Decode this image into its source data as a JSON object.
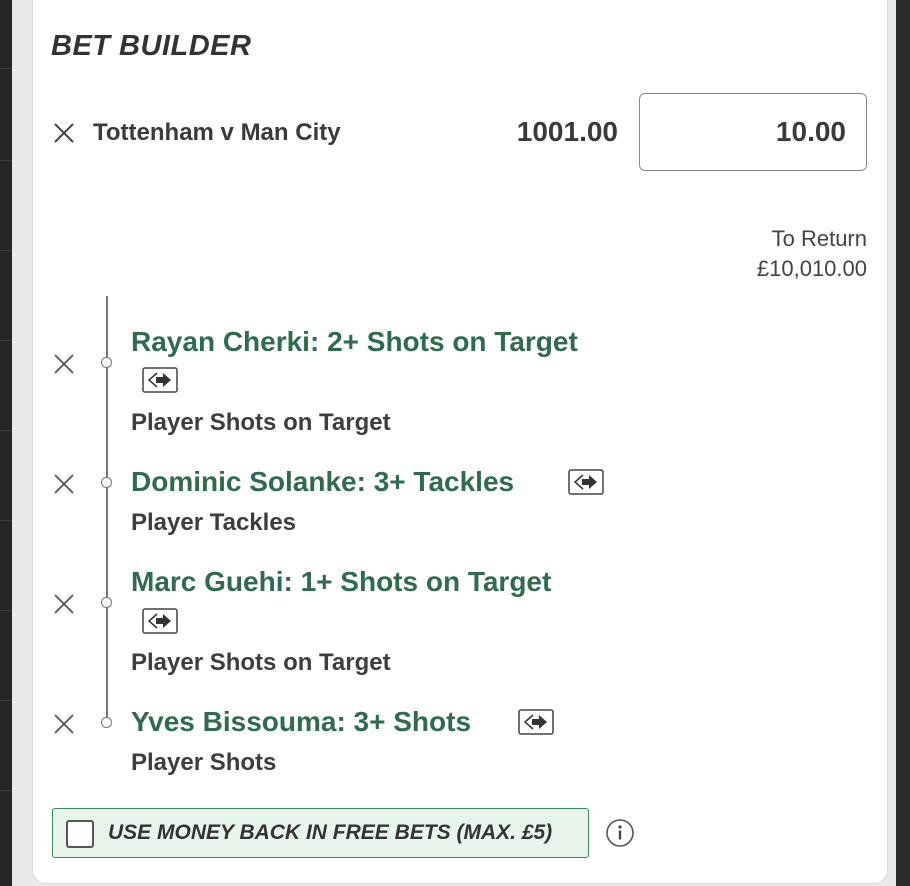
{
  "bet_builder": {
    "title": "BET BUILDER",
    "match": "Tottenham v Man City",
    "odds": "1001.00",
    "stake": "10.00",
    "to_return_label": "To Return",
    "to_return_value": "£10,010.00"
  },
  "selections": [
    {
      "title": "Rayan Cherki: 2+ Shots on Target",
      "market": "Player Shots on Target"
    },
    {
      "title": "Dominic Solanke: 3+ Tackles",
      "market": "Player Tackles"
    },
    {
      "title": "Marc Guehi: 1+ Shots on Target",
      "market": "Player Shots on Target"
    },
    {
      "title": "Yves Bissouma: 3+ Shots",
      "market": "Player Shots"
    }
  ],
  "money_back": {
    "label": "USE MONEY BACK IN FREE BETS (MAX. £5)",
    "checked": false
  },
  "icons": {
    "remove": "close-icon",
    "swap": "swap-icon",
    "info": "info-icon"
  },
  "colors": {
    "selection_green": "#2f6b4e",
    "money_back_border": "#3b8a5c",
    "money_back_bg": "#e7f5ec"
  }
}
